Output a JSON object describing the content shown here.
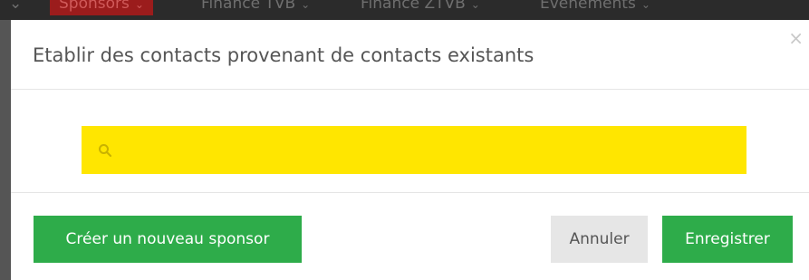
{
  "nav": {
    "items": [
      {
        "label": "Sponsors",
        "active": true
      },
      {
        "label": "Finance TVB",
        "active": false
      },
      {
        "label": "Finance ZTVB",
        "active": false
      },
      {
        "label": "Evenements",
        "active": false
      }
    ]
  },
  "modal": {
    "title": "Etablir des contacts provenant de contacts existants",
    "close_symbol": "×",
    "search": {
      "value": "",
      "placeholder": "",
      "background": "#ffe600",
      "icon": "search-icon"
    },
    "buttons": {
      "create_sponsor": "Créer un nouveau sponsor",
      "cancel": "Annuler",
      "save": "Enregistrer"
    }
  },
  "colors": {
    "primary": "#2eac4a",
    "highlight": "#ffe600",
    "nav_active": "#9b1c1c"
  }
}
